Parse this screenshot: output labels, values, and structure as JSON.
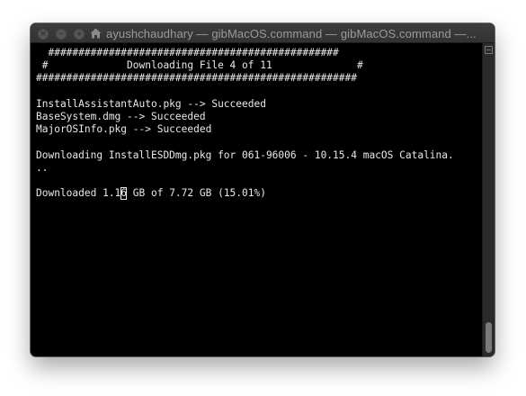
{
  "window": {
    "title": "ayushchaudhary — gibMacOS.command — gibMacOS.command —..."
  },
  "icons": {
    "close": "close-icon",
    "minimize": "minimize-icon",
    "zoom": "zoom-icon",
    "home": "home-folder-icon",
    "scroll": "scroll-toggle-icon"
  },
  "terminal": {
    "lines": [
      "  ################################################",
      " #             Downloading File 4 of 11              #",
      "#####################################################",
      "",
      "InstallAssistantAuto.pkg --> Succeeded",
      "BaseSystem.dmg --> Succeeded",
      "MajorOSInfo.pkg --> Succeeded",
      "",
      "Downloading InstallESDDmg.pkg for 061-96006 - 10.15.4 macOS Catalina.",
      ".."
    ],
    "blank_after": "",
    "progress_before_cursor": "Downloaded 1.1",
    "cursor_char": "6",
    "progress_after_cursor": " GB of 7.72 GB (15.01%)"
  },
  "colors": {
    "background": "#000000",
    "text": "#e8e8e8",
    "titlebar": "#363636",
    "title_text": "#9a9a9a"
  },
  "scrollbar": {
    "position": 0.98
  }
}
